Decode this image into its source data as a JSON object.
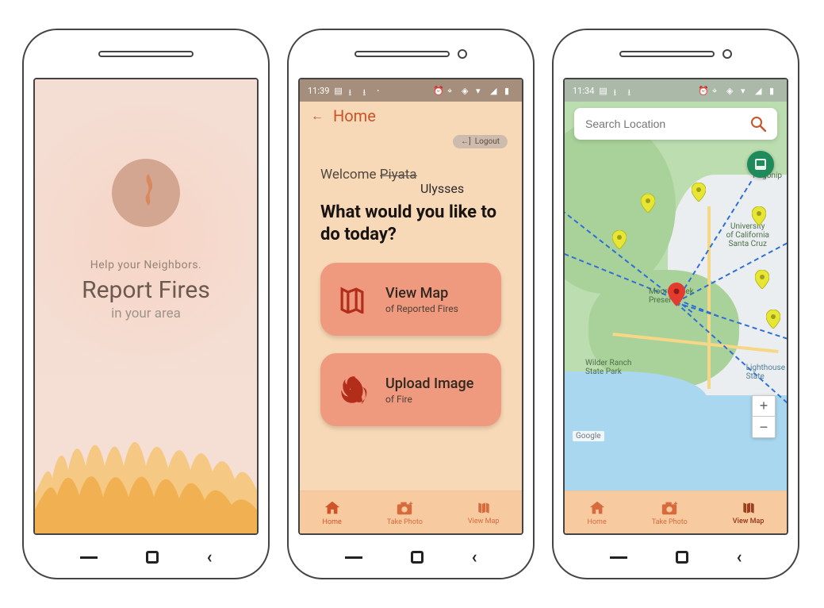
{
  "splash": {
    "tagline_top": "Help your Neighbors.",
    "headline": "Report Fires",
    "tagline_bottom": "in your area"
  },
  "status2": {
    "time": "11:39"
  },
  "status3": {
    "time": "11:34"
  },
  "home": {
    "title": "Home",
    "logout_label": "Logout",
    "welcome_prefix": "Welcome ",
    "welcome_strikethrough": "Piyata",
    "welcome_replacement": "Ulysses",
    "prompt": "What would you like to do today?",
    "tile_viewmap_title": "View Map",
    "tile_viewmap_sub": "of Reported Fires",
    "tile_upload_title": "Upload Image",
    "tile_upload_sub": "of Fire"
  },
  "bottomnav": {
    "home": "Home",
    "take_photo": "Take Photo",
    "view_map": "View Map"
  },
  "map": {
    "search_placeholder": "Search Location",
    "attribution": "Google",
    "labels": {
      "ucsc": "University\nof California\nSanta Cruz",
      "moore": "Moore Creek\nPreserve",
      "wilder": "Wilder Ranch\nState Park",
      "lighthouse": "Lighthouse\nState",
      "pogonip": "Pogonip"
    },
    "zoom_in": "+",
    "zoom_out": "−"
  }
}
